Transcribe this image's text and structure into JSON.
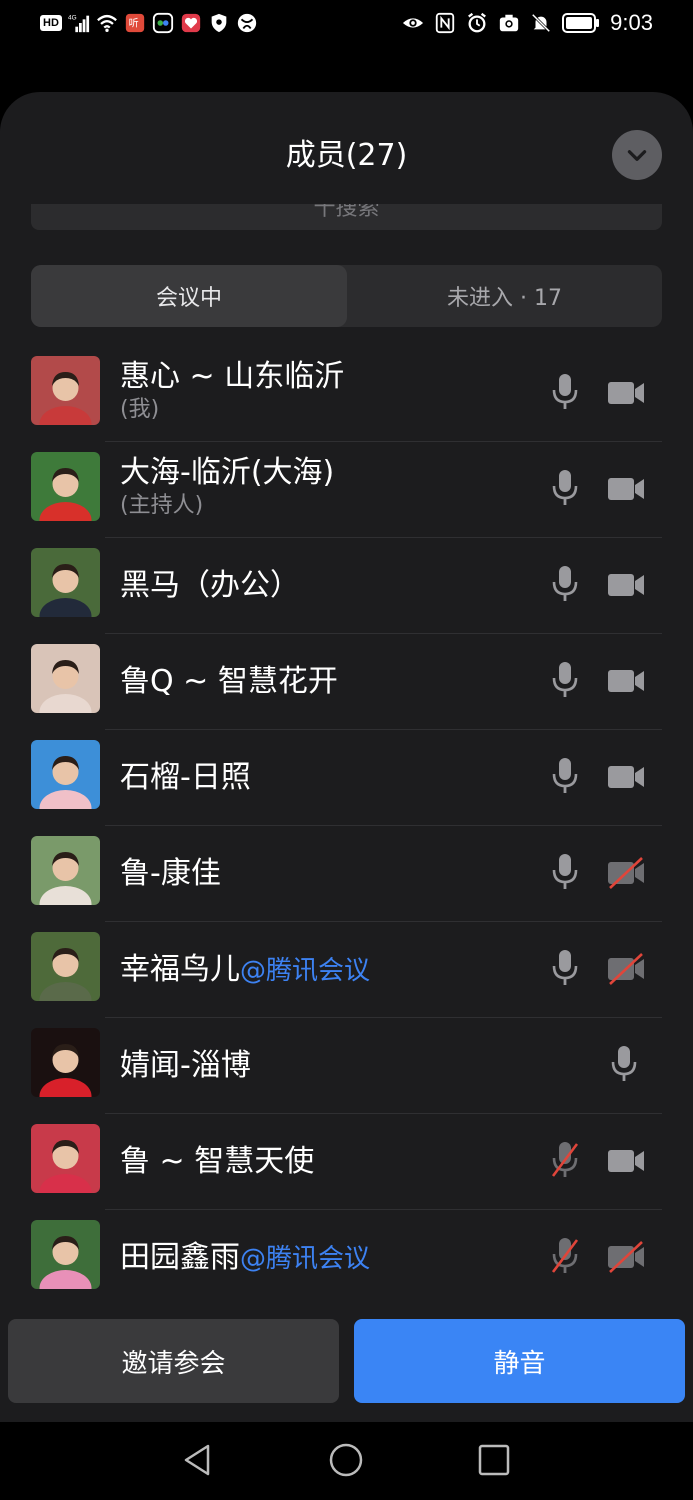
{
  "status_bar": {
    "hd": "HD",
    "network": "4G",
    "time": "9:03"
  },
  "header": {
    "title": "成员(27)",
    "search_partial": "十搜索"
  },
  "tabs": {
    "active": "会议中",
    "inactive": "未进入 · 17"
  },
  "members": [
    {
      "name": "惠心 ~ 山东临沂",
      "tag": "",
      "sub": "(我)",
      "mic": "on",
      "cam": "on",
      "avatar_bg": "#b24a4a"
    },
    {
      "name": "大海-临沂(大海)",
      "tag": "",
      "sub": "(主持人)",
      "mic": "on",
      "cam": "on",
      "avatar_bg": "#3e7a3a"
    },
    {
      "name": "黑马（办公）",
      "tag": "",
      "sub": "",
      "mic": "on",
      "cam": "on",
      "avatar_bg": "#4a6a3a"
    },
    {
      "name": "鲁Q ~ 智慧花开",
      "tag": "",
      "sub": "",
      "mic": "on",
      "cam": "on",
      "avatar_bg": "#d9c4b8"
    },
    {
      "name": "石榴-日照",
      "tag": "",
      "sub": "",
      "mic": "on",
      "cam": "on",
      "avatar_bg": "#3d8fd8"
    },
    {
      "name": "鲁-康佳",
      "tag": "",
      "sub": "",
      "mic": "on",
      "cam": "off",
      "avatar_bg": "#7a9a6a"
    },
    {
      "name": "幸福鸟儿",
      "tag": "@腾讯会议",
      "sub": "",
      "mic": "on",
      "cam": "off",
      "avatar_bg": "#4e6a3a"
    },
    {
      "name": "婧闻-淄博",
      "tag": "",
      "sub": "",
      "mic": "on",
      "cam": "none",
      "avatar_bg": "#1a1010"
    },
    {
      "name": "鲁 ~ 智慧天使",
      "tag": "",
      "sub": "",
      "mic": "off",
      "cam": "on",
      "avatar_bg": "#c83a4a"
    },
    {
      "name": "田园鑫雨",
      "tag": "@腾讯会议",
      "sub": "",
      "mic": "off",
      "cam": "off",
      "avatar_bg": "#3e6e3a"
    }
  ],
  "buttons": {
    "invite": "邀请参会",
    "mute": "静音"
  },
  "colors": {
    "sheet_bg": "#1c1c1e",
    "accent_blue": "#3a85f5",
    "tag_blue": "#3d82f2",
    "muted_red": "#e0453a",
    "icon_gray": "#9a9a9e"
  }
}
